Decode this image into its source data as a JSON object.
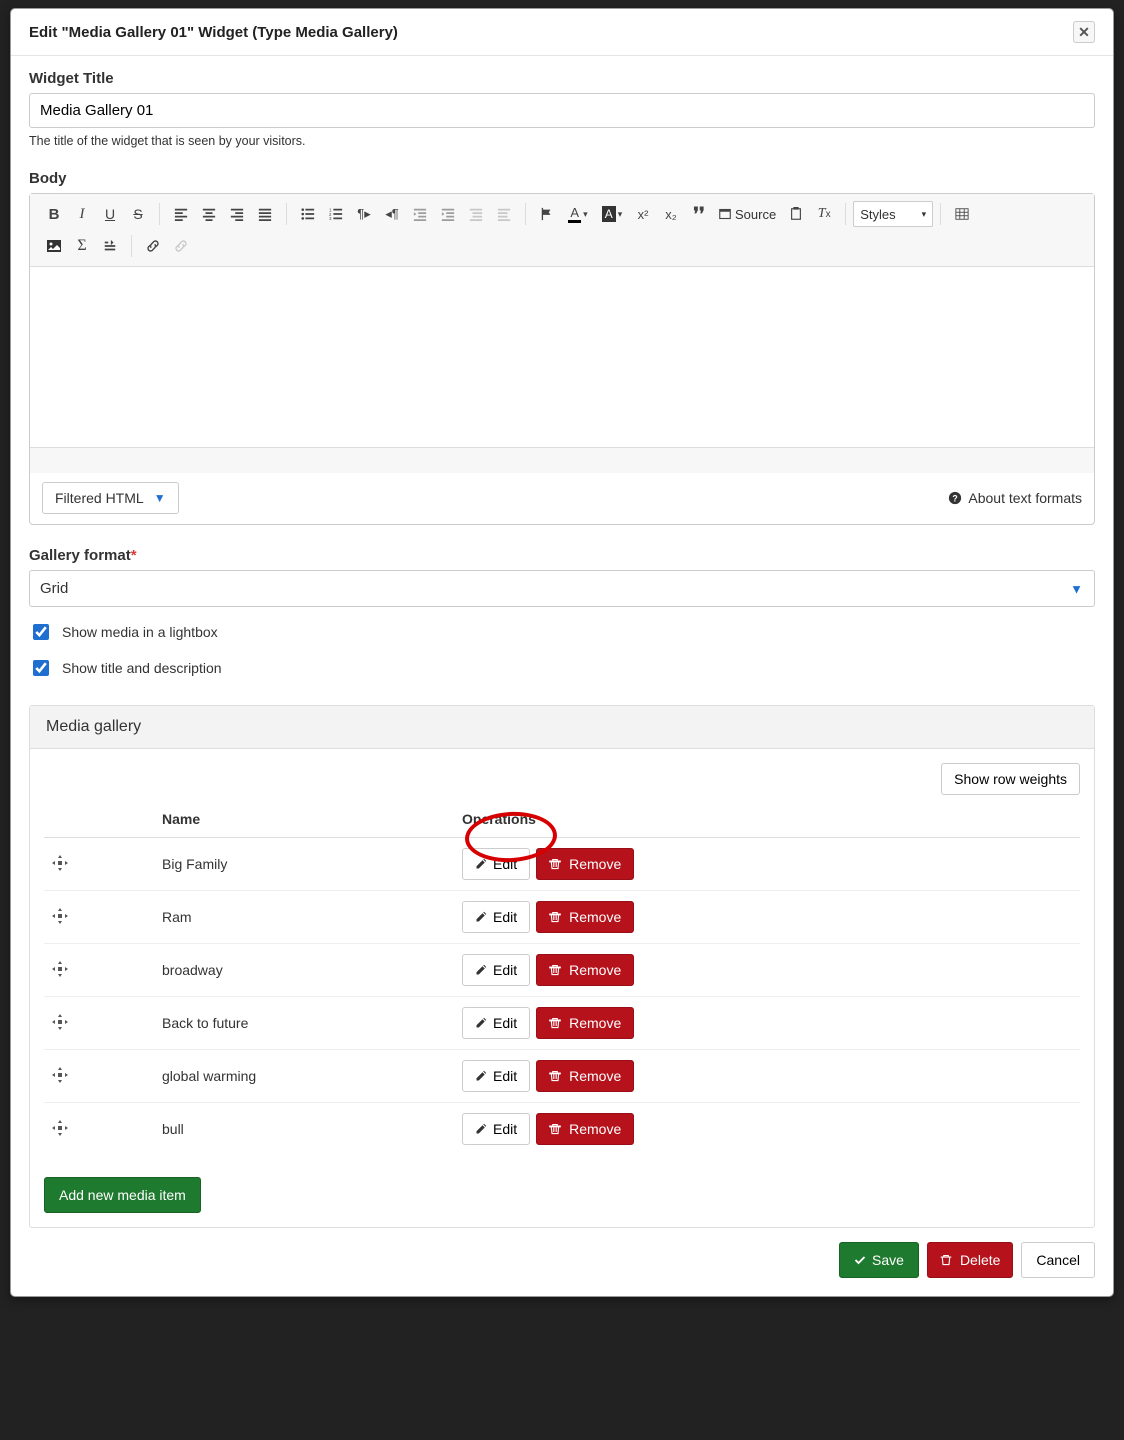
{
  "modal": {
    "title": "Edit \"Media Gallery 01\" Widget (Type Media Gallery)"
  },
  "widgetTitle": {
    "label": "Widget Title",
    "value": "Media Gallery 01",
    "help": "The title of the widget that is seen by your visitors."
  },
  "body": {
    "label": "Body",
    "sourceLabel": "Source",
    "stylesLabel": "Styles"
  },
  "format": {
    "selected": "Filtered HTML",
    "aboutLabel": "About text formats"
  },
  "galleryFormat": {
    "label": "Gallery format",
    "required": "*",
    "selected": "Grid"
  },
  "checkboxes": {
    "lightbox": "Show media in a lightbox",
    "titleDesc": "Show title and description"
  },
  "mediaGallery": {
    "panelTitle": "Media gallery",
    "showRowWeights": "Show row weights",
    "cols": {
      "name": "Name",
      "operations": "Operations"
    },
    "editLabel": "Edit",
    "removeLabel": "Remove",
    "addLabel": "Add new media item",
    "rows": [
      {
        "name": "Big Family"
      },
      {
        "name": "Ram"
      },
      {
        "name": "broadway"
      },
      {
        "name": "Back to future"
      },
      {
        "name": "global warming"
      },
      {
        "name": "bull"
      }
    ]
  },
  "footer": {
    "save": "Save",
    "delete": "Delete",
    "cancel": "Cancel"
  }
}
